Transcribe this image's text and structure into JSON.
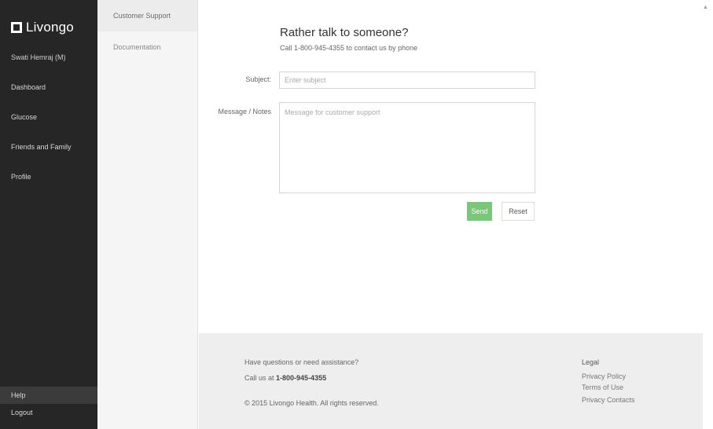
{
  "brand": {
    "name": "Livongo"
  },
  "sidebar": {
    "user": "Swati Hemraj (M)",
    "items": [
      {
        "label": "Dashboard"
      },
      {
        "label": "Glucose"
      },
      {
        "label": "Friends and Family"
      },
      {
        "label": "Profile"
      }
    ],
    "bottom": [
      {
        "label": "Help"
      },
      {
        "label": "Logout"
      }
    ]
  },
  "submenu": {
    "items": [
      {
        "label": "Customer Support"
      },
      {
        "label": "Documentation"
      }
    ]
  },
  "form": {
    "heading": "Rather talk to someone?",
    "subheading": "Call 1-800-945-4355 to contact us by phone",
    "subject_label": "Subject:",
    "subject_placeholder": "Enter subject",
    "message_label": "Message / Notes",
    "message_placeholder": "Message for customer support",
    "send_label": "Send",
    "reset_label": "Reset"
  },
  "footer": {
    "question": "Have questions or need assistance?",
    "call_prefix": "Call us at ",
    "phone": "1-800-945-4355",
    "copyright": "© 2015 Livongo Health. All rights reserved.",
    "legal_title": "Legal",
    "links": [
      {
        "label": "Privacy Policy"
      },
      {
        "label": "Terms of Use"
      },
      {
        "label": "Privacy Contacts"
      }
    ]
  },
  "colors": {
    "sidebar_bg": "#262626",
    "send_button": "#7bc67b"
  },
  "icons": {
    "logo": "livongo-logo-icon",
    "scroll": "scroll-up-arrow-icon"
  }
}
